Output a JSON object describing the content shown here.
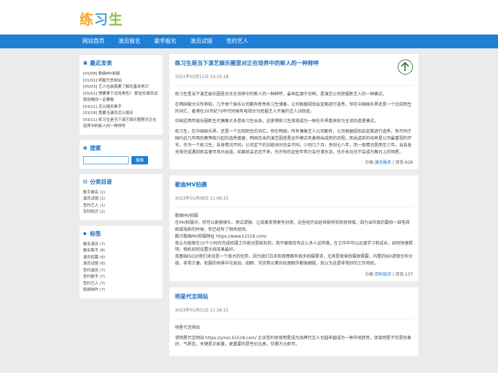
{
  "logo": {
    "c1": "练",
    "c2": "习",
    "c3": "生"
  },
  "nav": [
    "网站首页",
    "演员报名",
    "歌手报名",
    "演员试镜",
    "签约艺人"
  ],
  "recent": {
    "title": "最近发表",
    "items": [
      "[01/08] 歌曲MV拍摄",
      "[01/01] 明星代言网站",
      "[05/03] 艺人包装需要了解的基本常识",
      "[05/01] 想要拿下试戏角色？ 那这份演员试镜攻略你一定要看",
      "[03/21] 怎么报名歌手",
      "[03/18] 我要当演员怎么报名",
      "[03/11] 练习生是当下演艺娱乐圈里对正在培养中的新人的一种称呼"
    ]
  },
  "search": {
    "title": "搜索",
    "button": "搜索",
    "value": ""
  },
  "categories": {
    "title": "分类目录",
    "items": [
      "歌手报名 (1)",
      "演员试镜 (1)",
      "签约艺人 (1)",
      "百科知识 (2)"
    ]
  },
  "tags": {
    "title": "标签",
    "items": [
      "报名演员 (7)",
      "报名歌手 (8)",
      "演员招募 (6)",
      "演员试镜 (6)",
      "签约演员 (7)",
      "签约歌手 (7)",
      "签约艺人 (7)",
      "视频制作 (7)"
    ]
  },
  "posts": [
    {
      "title": "练习生是当下演艺娱乐圈里对正在培养中的新人的一种称呼",
      "date": "2021年03月11日 10:15:18",
      "paras": [
        "练习生是当下演艺娱乐圈里对正在培养中的新人的一种称呼，最早起源于日韩，是演艺公司挖掘新艺人的一种模式。",
        "在韩国被大众所熟知，几乎每个娱乐公司都有新秀练习生储备，公司根据规划会定期进行选秀，但在中国娱乐界还是一个比较陌生的词汇，香港在20世纪70年代时候有电视台为挖掘艺人开展的艺人训练班。",
        "中国近两年娱乐圈新生代偶像大多是练习生出身，这使得练习生渐渐成为一种在外界看来较为主流的造星模式。",
        "练习生，在中国娱乐界，还是一个比较陌生的词汇。但在韩国，所有偶像艺人公司都有，公司根据规划会定期进行选秀，但不同于国内近几年雨后春笋般兴起的选秀盛宴，韩国日本的演艺圈造星运作模式有着相当成熟的流程。而出道前的培养是公司最重视的环节。作为一个练习生，自身情况不同，公司定下的训练时间也会不同，少则几个月，多则七八年，而一般情况是两至三年。当自身充电完成遇到机会便可风光出道，如果机会迟迟不来，也许你的这些年努力会付诸东流，也许永远也不会成为舞台上的明星。"
      ],
      "category_label": "分类:",
      "category": "演员报名",
      "views": "| 浏览:628"
    },
    {
      "title": "歌曲MV拍摄",
      "date": "2023年01月08日 11:08:31",
      "paras": [
        "歌曲MV拍摄\n在MV拍摄中，你可以更换镜头、测试滤镜、让效果变得更有创意。这些经历会延续影响到其他领域，因为当你真的要拍一部电视剧或电影的时候，你已经有了相关经验。\n酷万歌曲MV拍摄网址 https://www.k1518.com/\n我认为能够在10个小时内完成拍摄工作绝对是疯狂的，我不敢相信有这么多人这样做。在工作中可以迅速学习和成长，如何快速照明、相机如何设置光线效果最好。\n双基础ISO对我们来说是一个很大的优势，因为我们白天和夜晚都有很多拍摄需求，尤其是夜景拍摄很需要。内置的ND滤镜也有分级，非常方便。拍摄的场景中垃圾站、田野、河流等元素的纹理细节都很细腻，我认为这是非常好的工作用机。"
      ],
      "category_label": "分类:",
      "category": "百科知识",
      "views": "| 浏览:137"
    },
    {
      "title": "明星代言网站",
      "date": "2023年01月01日 11:18:31",
      "paras": [
        "明星代言网站",
        "请明星代言网站 https://yiren.k1518.com/ 企业签约体育明星成为品牌代言人也越来越成为一种市场趋势，体育明星不仅是形象好，气质佳，关键是正能量，更重要的是性价比高，仅需万元即可。"
      ]
    }
  ]
}
